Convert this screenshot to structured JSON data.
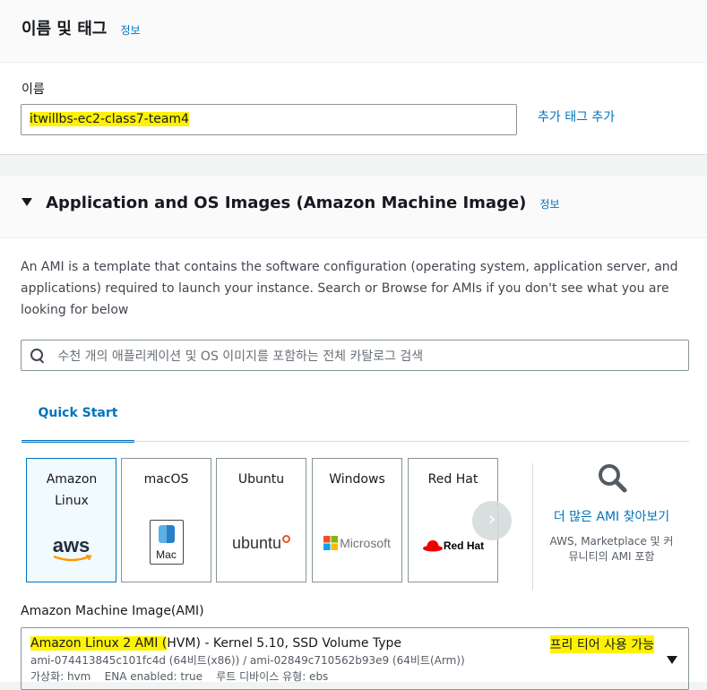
{
  "name_tags": {
    "title": "이름 및 태그",
    "info": "정보",
    "name_label": "이름",
    "name_value": "itwillbs-ec2-class7-team4",
    "add_tag": "추가 태그 추가"
  },
  "ami_section": {
    "title": "Application and OS Images (Amazon Machine Image)",
    "info": "정보",
    "description": "An AMI is a template that contains the software configuration (operating system, application server, and applications) required to launch your instance. Search or Browse for AMIs if you don't see what you are looking for below",
    "search_placeholder": "수천 개의 애플리케이션 및 OS 이미지를 포함하는 전체 카탈로그 검색",
    "tab_quick_start": "Quick Start",
    "tiles": [
      {
        "label": "Amazon Linux",
        "logo": "aws"
      },
      {
        "label": "macOS",
        "logo": "Mac"
      },
      {
        "label": "Ubuntu",
        "logo": "ubuntu"
      },
      {
        "label": "Windows",
        "logo": "Microsoft"
      },
      {
        "label": "Red Hat",
        "logo": "Red Hat"
      }
    ],
    "more_link": "더 많은 AMI 찾아보기",
    "more_sub": "AWS, Marketplace 및 커뮤니티의 AMI 포함",
    "ami_label": "Amazon Machine Image(AMI)",
    "ami_title": "Amazon Linux 2 AMI (HVM) - Kernel 5.10, SSD Volume Type",
    "ami_title_highlight": "Amazon Linux 2 AMI (",
    "ami_title_rest": "HVM) - Kernel 5.10, SSD Volume Type",
    "ami_ids": "ami-074413845c101fc4d (64비트(x86)) / ami-02849c710562b93e9 (64비트(Arm))",
    "ami_meta": "가상화: hvm    ENA enabled: true    루트 디바이스 유형: ebs",
    "free_tier": "프리 티어 사용 가능"
  },
  "colors": {
    "link": "#0073bb",
    "highlight": "#fff200",
    "aws_orange": "#ff9900",
    "ubuntu_orange": "#e95420",
    "redhat_red": "#ee0000"
  }
}
